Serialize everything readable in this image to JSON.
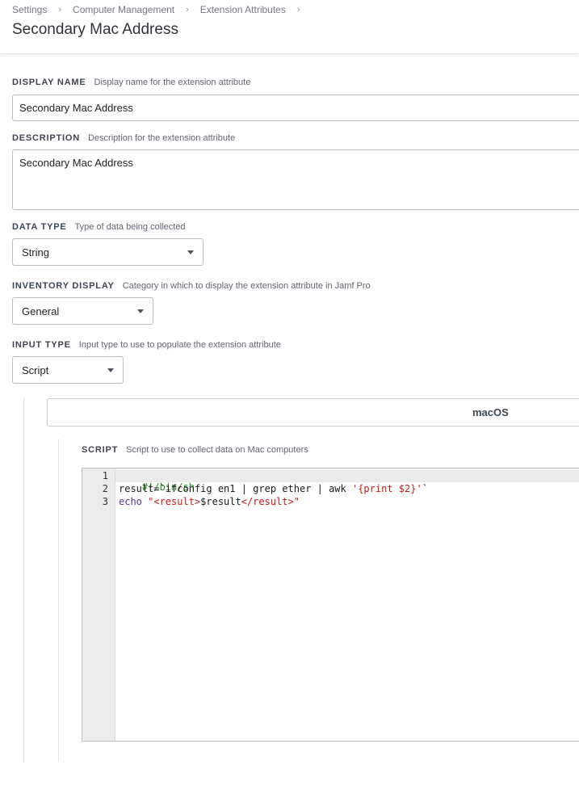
{
  "breadcrumb": {
    "items": [
      "Settings",
      "Computer Management",
      "Extension Attributes"
    ],
    "separator": "›"
  },
  "page_title": "Secondary Mac Address",
  "display_name": {
    "label": "DISPLAY NAME",
    "help": "Display name for the extension attribute",
    "value": "Secondary Mac Address"
  },
  "description": {
    "label": "DESCRIPTION",
    "help": "Description for the extension attribute",
    "value": "Secondary Mac Address"
  },
  "data_type": {
    "label": "DATA TYPE",
    "help": "Type of data being collected",
    "value": "String"
  },
  "inventory_display": {
    "label": "INVENTORY DISPLAY",
    "help": "Category in which to display the extension attribute in Jamf Pro",
    "value": "General"
  },
  "input_type": {
    "label": "INPUT TYPE",
    "help": "Input type to use to populate the extension attribute",
    "value": "Script"
  },
  "platform_tab": {
    "label": "macOS"
  },
  "script": {
    "label": "SCRIPT",
    "help": "Script to use to collect data on Mac computers",
    "line_numbers": [
      "1",
      "2",
      "3"
    ],
    "line1": "#!/bin/sh",
    "line2_a": "result=`ifconfig en1 | grep ether | awk ",
    "line2_b": "'{print $2}'",
    "line2_c": "`",
    "line3_a": "echo",
    "line3_b": " \"<result>",
    "line3_c": "$result",
    "line3_d": "</result>\""
  },
  "colors": {
    "accent_text": "#3b4650",
    "border": "#b9bfc5",
    "comment": "#2c8a2c",
    "string": "#c41a16",
    "keyword": "#5b2d8e"
  }
}
